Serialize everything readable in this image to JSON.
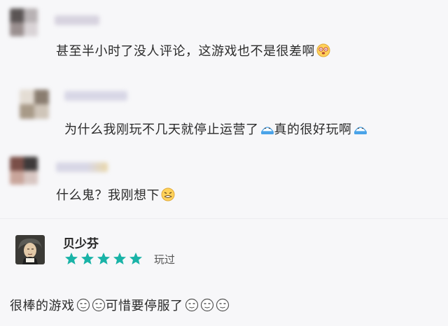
{
  "comments": [
    {
      "text": "甚至半小时了没人评论，这游戏也不是很差啊"
    },
    {
      "text_a": "为什么我刚玩不几天就停止运营了",
      "text_b": "真的很好玩啊"
    },
    {
      "text": "什么鬼？我刚想下"
    }
  ],
  "review": {
    "username": "贝少芬",
    "rating": 5,
    "rating_max": 5,
    "played_label": "玩过",
    "text_a": "很棒的游戏",
    "text_b": "可惜要停服了"
  },
  "colors": {
    "star": "#19b3a7",
    "emoji_face": "#ffd25a",
    "cry_blue": "#4aa3e8"
  },
  "icons": [
    "dizzy-face-icon",
    "crying-face-icon",
    "grimace-face-icon",
    "sweat-smile-icon"
  ]
}
